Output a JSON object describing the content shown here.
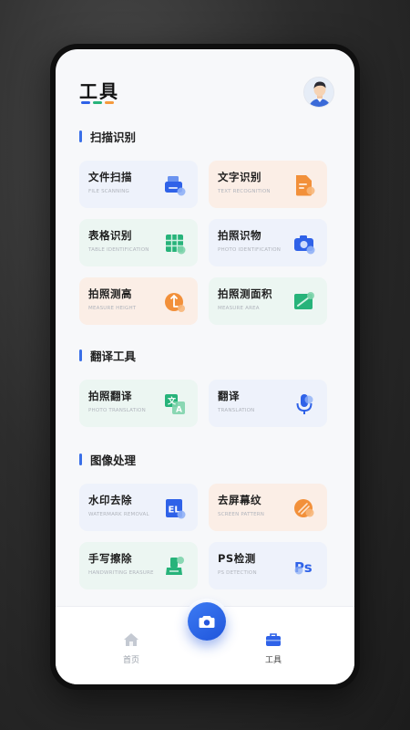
{
  "header": {
    "title": "工具",
    "accent_colors": [
      "#2f62e8",
      "#27b37a",
      "#f59a3c"
    ]
  },
  "sections": {
    "scan": {
      "title": "扫描识别",
      "items": [
        {
          "label": "文件扫描",
          "sub": "FILE SCANNING",
          "icon": "scanner-icon",
          "tint": "blue"
        },
        {
          "label": "文字识别",
          "sub": "TEXT RECOGNITION",
          "icon": "document-text-icon",
          "tint": "orange"
        },
        {
          "label": "表格识别",
          "sub": "TABLE IDENTIFICATION",
          "icon": "table-icon",
          "tint": "green"
        },
        {
          "label": "拍照识物",
          "sub": "PHOTO IDENTIFICATION",
          "icon": "camera-icon",
          "tint": "blue"
        },
        {
          "label": "拍照测高",
          "sub": "MEASURE HEIGHT",
          "icon": "height-measure-icon",
          "tint": "orange"
        },
        {
          "label": "拍照测面积",
          "sub": "MEASURE AREA",
          "icon": "area-measure-icon",
          "tint": "green"
        }
      ]
    },
    "translate": {
      "title": "翻译工具",
      "items": [
        {
          "label": "拍照翻译",
          "sub": "PHOTO TRANSLATION",
          "icon": "translate-icon",
          "tint": "green"
        },
        {
          "label": "翻译",
          "sub": "TRANSLATION",
          "icon": "microphone-icon",
          "tint": "blue"
        }
      ]
    },
    "image": {
      "title": "图像处理",
      "items": [
        {
          "label": "水印去除",
          "sub": "WATERMARK REMOVAL",
          "icon": "watermark-icon",
          "tint": "blue"
        },
        {
          "label": "去屏幕纹",
          "sub": "SCREEN PATTERN",
          "icon": "screen-pattern-icon",
          "tint": "orange"
        },
        {
          "label": "手写擦除",
          "sub": "HANDWRITING ERASURE",
          "icon": "eraser-icon",
          "tint": "green"
        },
        {
          "label": "PS检测",
          "sub": "PS DETECTION",
          "icon": "ps-detect-icon",
          "tint": "blue"
        }
      ]
    }
  },
  "tabbar": {
    "home": "首页",
    "tools": "工具",
    "camera_icon": "camera-icon"
  },
  "colors": {
    "primary": "#2f62e8",
    "orange": "#f2903a",
    "green": "#27b37a"
  }
}
